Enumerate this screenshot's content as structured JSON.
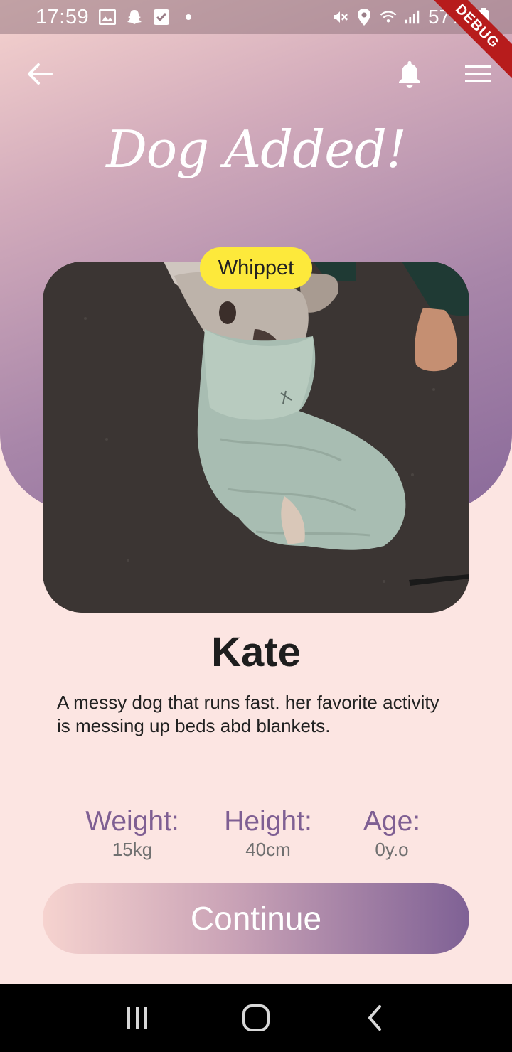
{
  "status_bar": {
    "time": "17:59",
    "battery": "57%",
    "icons": [
      "gallery-icon",
      "snapchat-icon",
      "checkbox-icon",
      "dot-icon",
      "mute-icon",
      "location-icon",
      "wifi-icon",
      "signal-icon",
      "battery-icon"
    ]
  },
  "debug_banner": "DEBUG",
  "app_bar": {
    "back_icon": "back-arrow-icon",
    "bell_icon": "bell-icon",
    "menu_icon": "menu-icon"
  },
  "title": "Dog Added!",
  "dog": {
    "breed": "Whippet",
    "name": "Kate",
    "description": "A messy dog that runs fast. her favorite activity is messing up beds abd blankets."
  },
  "stats": {
    "weight_label": "Weight:",
    "weight_value": "15kg",
    "height_label": "Height:",
    "height_value": "40cm",
    "age_label": "Age:",
    "age_value": "0y.o"
  },
  "continue_label": "Continue",
  "colors": {
    "accent_purple": "#7f5f93",
    "badge_yellow": "#fde93b",
    "background": "#fce5e2"
  }
}
